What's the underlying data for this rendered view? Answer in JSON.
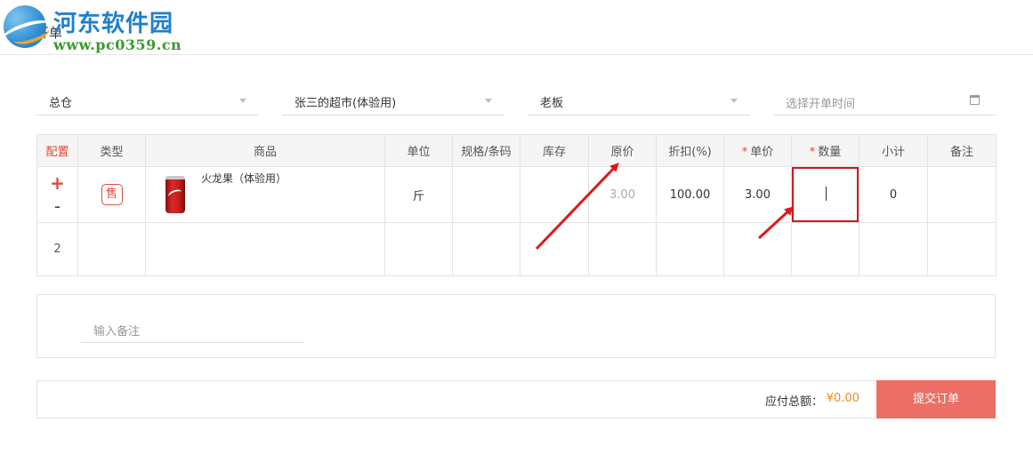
{
  "watermark": {
    "title": "河东软件园",
    "url": "www.pc0359.cn"
  },
  "page": {
    "title": "开单"
  },
  "filters": {
    "warehouse": "总仓",
    "store": "张三的超市(体验用)",
    "operator": "老板",
    "time_placeholder": "选择开单时间"
  },
  "table": {
    "headers": {
      "config": "配置",
      "type": "类型",
      "product": "商品",
      "unit": "单位",
      "spec": "规格/条码",
      "stock": "库存",
      "orig_price": "原价",
      "discount": "折扣(%)",
      "unit_price": "单价",
      "qty": "数量",
      "subtotal": "小计",
      "note": "备注"
    },
    "required_mark": "*",
    "rows": [
      {
        "plus": "+",
        "minus": "-",
        "type_badge": "售",
        "product_name": "火龙果（体验用）",
        "unit": "斤",
        "spec": "",
        "stock": "",
        "orig_price": "3.00",
        "discount": "100.00",
        "unit_price": "3.00",
        "qty": "",
        "subtotal": "0",
        "note": ""
      },
      {
        "index": "2"
      }
    ]
  },
  "remark": {
    "placeholder": "输入备注"
  },
  "footer": {
    "total_label": "应付总额：",
    "total_value": "¥0.00",
    "submit_label": "提交订单"
  },
  "colors": {
    "accent": "#e04a3a",
    "submit": "#ec6f65",
    "total": "#f08a1e",
    "highlight": "#d0181e"
  }
}
